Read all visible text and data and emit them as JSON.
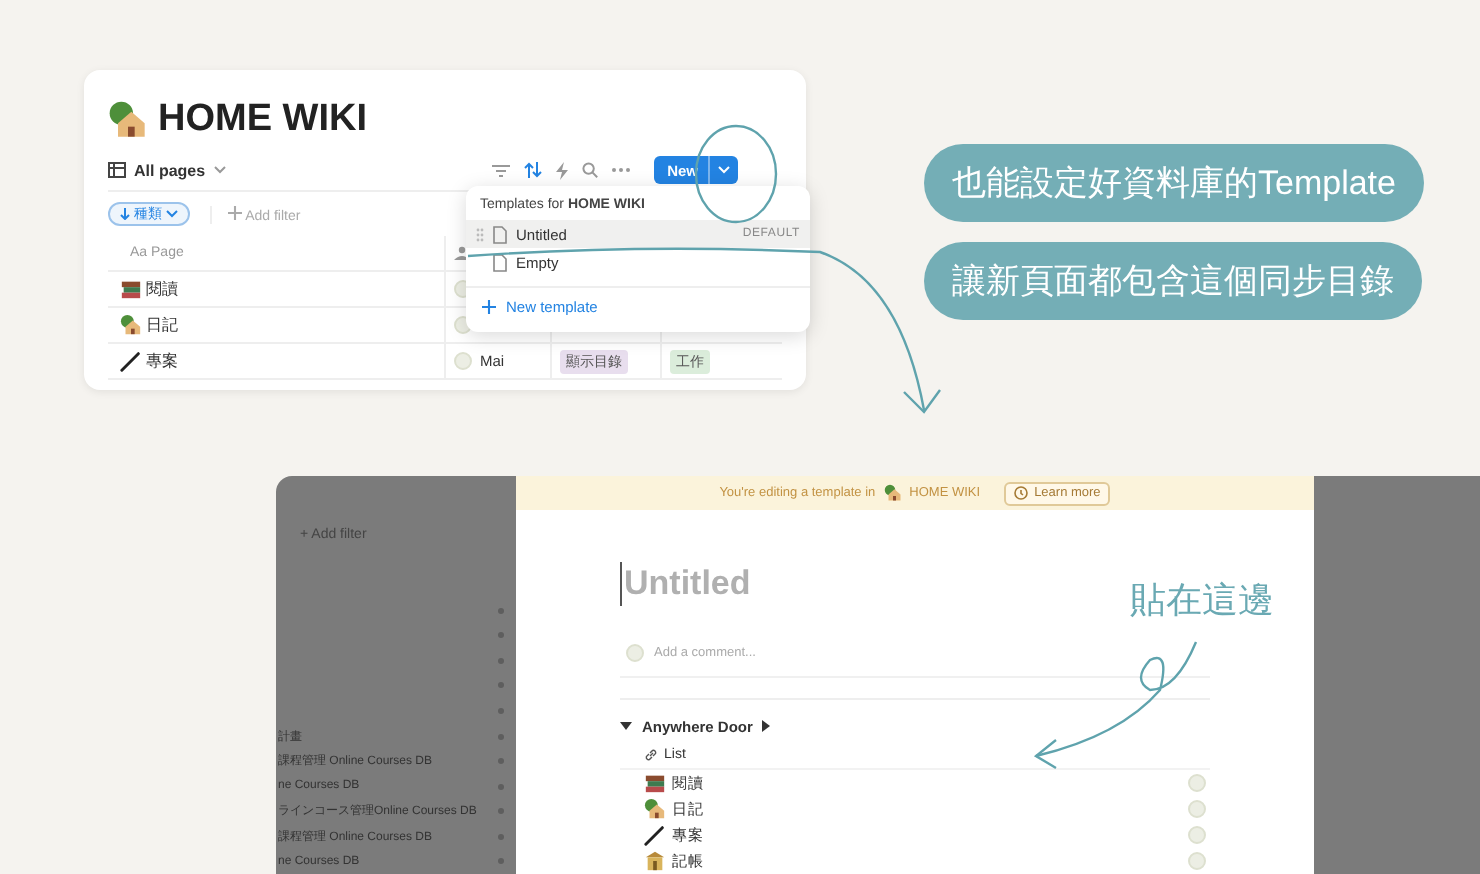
{
  "template_card": {
    "title": "HOME WIKI",
    "view": "All pages",
    "new_button": "New",
    "filter_chip": "種類",
    "add_filter": "Add filter",
    "column_type": "Aa",
    "column_header": "Page",
    "rows": [
      {
        "name": "閱讀"
      },
      {
        "name": "日記"
      },
      {
        "name": "專案",
        "person": "Mai",
        "tags": [
          {
            "label": "顯示目錄",
            "color": "#e8deee"
          },
          {
            "label": "工作",
            "color": "#dbeddb"
          }
        ]
      }
    ]
  },
  "template_menu": {
    "heading": "Templates for **HOME WIKI**",
    "items": [
      {
        "label": "Untitled",
        "badge": "DEFAULT",
        "selected": true
      },
      {
        "label": "Empty",
        "selected": false
      }
    ],
    "new_template": "New template"
  },
  "callouts": [
    "也能設定好資料庫的Template",
    "讓新頁面都包含這個同步目錄"
  ],
  "editor": {
    "backdrop_filter": "+ Add filter",
    "backdrop_rows": [
      "",
      "",
      "",
      "",
      "",
      "計畫",
      "課程管理 Online Courses DB",
      "ne Courses DB",
      "ラインコース管理Online Courses DB",
      "課程管理 Online Courses DB",
      "ne Courses DB"
    ],
    "banner_text": "You're editing a template in",
    "banner_db": "HOME WIKI",
    "learn_more": "Learn more",
    "title_placeholder": "Untitled",
    "comment_placeholder": "Add a comment...",
    "toggle": "Anywhere Door",
    "expanded": true,
    "link": "List",
    "items": [
      "閱讀",
      "日記",
      "專案",
      "記帳"
    ]
  },
  "note": "貼在這邊"
}
